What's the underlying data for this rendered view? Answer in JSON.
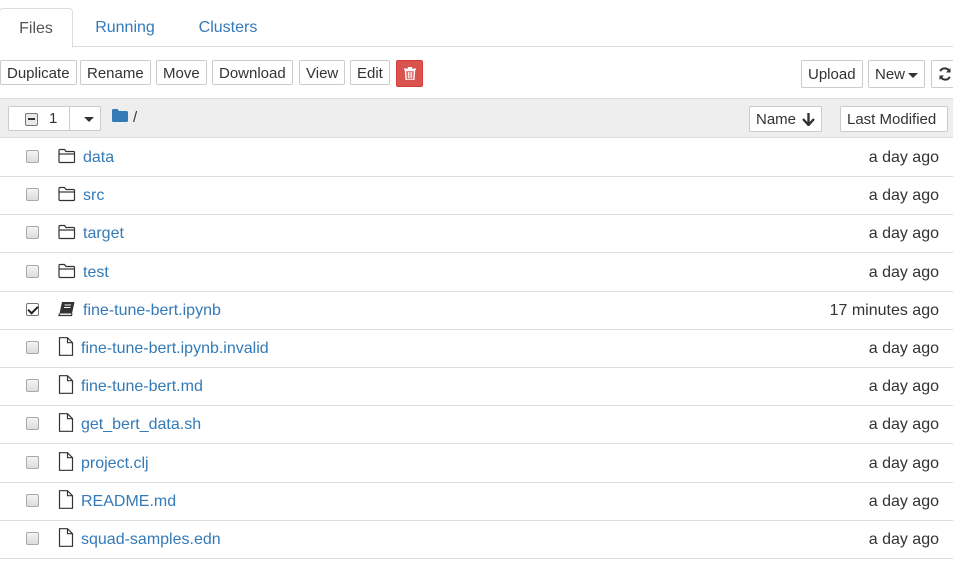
{
  "tabs": [
    {
      "label": "Files",
      "active": true
    },
    {
      "label": "Running",
      "active": false
    },
    {
      "label": "Clusters",
      "active": false
    }
  ],
  "toolbar": {
    "duplicate": "Duplicate",
    "rename": "Rename",
    "move": "Move",
    "download": "Download",
    "view": "View",
    "edit": "Edit",
    "delete_icon": "trash-icon",
    "upload": "Upload",
    "new": "New",
    "refresh_icon": "refresh-icon"
  },
  "list_header": {
    "selected_count": "1",
    "path": "/",
    "sort_name": "Name",
    "sort_modified": "Last Modified"
  },
  "colors": {
    "link": "#337ab7",
    "danger": "#d9534f",
    "header_bg": "#eeeeee"
  },
  "files": [
    {
      "name": "data",
      "type": "folder",
      "modified": "a day ago",
      "checked": false
    },
    {
      "name": "src",
      "type": "folder",
      "modified": "a day ago",
      "checked": false
    },
    {
      "name": "target",
      "type": "folder",
      "modified": "a day ago",
      "checked": false
    },
    {
      "name": "test",
      "type": "folder",
      "modified": "a day ago",
      "checked": false
    },
    {
      "name": "fine-tune-bert.ipynb",
      "type": "notebook",
      "modified": "17 minutes ago",
      "checked": true
    },
    {
      "name": "fine-tune-bert.ipynb.invalid",
      "type": "file",
      "modified": "a day ago",
      "checked": false
    },
    {
      "name": "fine-tune-bert.md",
      "type": "file",
      "modified": "a day ago",
      "checked": false
    },
    {
      "name": "get_bert_data.sh",
      "type": "file",
      "modified": "a day ago",
      "checked": false
    },
    {
      "name": "project.clj",
      "type": "file",
      "modified": "a day ago",
      "checked": false
    },
    {
      "name": "README.md",
      "type": "file",
      "modified": "a day ago",
      "checked": false
    },
    {
      "name": "squad-samples.edn",
      "type": "file",
      "modified": "a day ago",
      "checked": false
    }
  ]
}
